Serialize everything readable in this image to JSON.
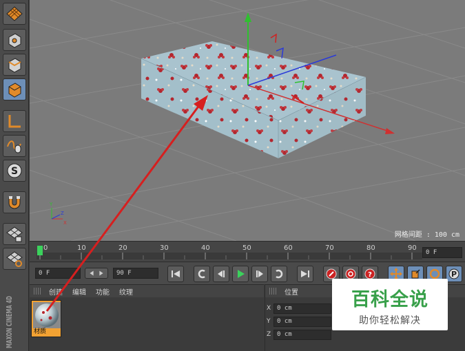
{
  "viewport": {
    "grid_spacing_label": "网格间距 : 100 cm"
  },
  "timeline": {
    "ticks": [
      "0",
      "10",
      "20",
      "30",
      "40",
      "50",
      "60",
      "70",
      "80",
      "90"
    ],
    "current_frame_field": "0 F"
  },
  "transport": {
    "start_frame_field": "0 F",
    "end_frame_field": "90 F"
  },
  "material_manager": {
    "menu": [
      "创建",
      "编辑",
      "功能",
      "纹理"
    ],
    "material_name": "材质"
  },
  "coordinates": {
    "header": "位置",
    "rows": [
      {
        "axis": "X",
        "value": "0 cm"
      },
      {
        "axis": "Y",
        "value": "0 cm"
      },
      {
        "axis": "Z",
        "value": "0 cm"
      }
    ]
  },
  "brand": {
    "vertical_logo": "MAXON CINEMA 4D"
  },
  "watermark": {
    "title": "百科全说",
    "subtitle": "助你轻松解决"
  },
  "colors": {
    "accent_blue": "#6d8fb8",
    "watermark_green": "#38a04a",
    "arrow_red": "#d61f1f",
    "material_swatch": "#f2a233"
  },
  "left_toolbar_icons": [
    "grid-checker-icon",
    "point-mode-icon",
    "edge-mode-icon",
    "polygon-mode-icon",
    "axis-icon",
    "tweak-icon",
    "snap-s-icon",
    "magnet-icon",
    "workplane-lock-icon",
    "grid-rotate-icon"
  ]
}
